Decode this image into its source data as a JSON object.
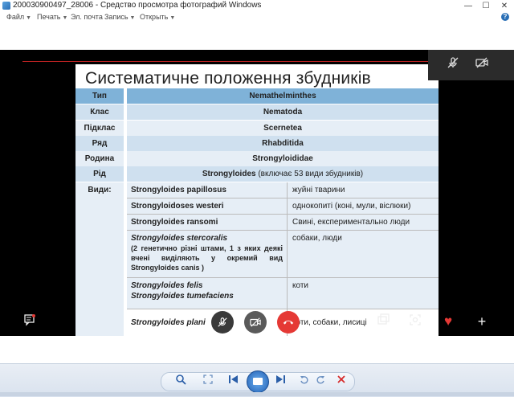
{
  "window": {
    "title": "200030900497_28006 - Средство просмотра фотографий Windows",
    "minimize": "—",
    "maximize": "☐",
    "close": "✕"
  },
  "menu": {
    "items": [
      "Файл",
      "Печать",
      "Эл. почта",
      "Запись",
      "Открыть"
    ],
    "help": "?"
  },
  "slide": {
    "title": "Систематичне положення збудників",
    "rows": [
      {
        "label": "Тип",
        "value": "Nemathelminthes"
      },
      {
        "label": "Клас",
        "value": "Nematoda"
      },
      {
        "label": "Підклас",
        "value": "Scernetea"
      },
      {
        "label": "Ряд",
        "value": "Rhabditida"
      },
      {
        "label": "Родина",
        "value": "Strongyloididae"
      },
      {
        "label": "Рід",
        "value": "Strongyloides",
        "value_extra": " (включає 53 види збудників)"
      }
    ],
    "species_label": "Види:",
    "species": [
      {
        "name": "Strongyloides  papillosus",
        "host": "жуйні тварини"
      },
      {
        "name": "Strongyloidoses westeri",
        "host": "однокопиті (коні, мули, віслюки)"
      },
      {
        "name": "Strongyloides ransomi",
        "host": "Свині, експериментально люди"
      },
      {
        "name": "Strongyloides stercoralis",
        "note": "(2 генетично різні штами, 1 з яких деякі вчені виділяють у окремий вид Strongyloides canis )",
        "host": "собаки, люди"
      },
      {
        "name": "Strongyloides felis",
        "name2": "Strongyloides tumefaciens",
        "host": "коти"
      },
      {
        "name": "Strongyloides plani",
        "host": "коти, собаки, лисиці"
      }
    ]
  },
  "colors": {
    "header_blue": "#7fb2d8",
    "row_light": "#cfe0ef",
    "end_call_red": "#e53935",
    "heart_red": "#e53935"
  },
  "toolbar": {
    "icons": [
      "zoom-icon",
      "fit-icon",
      "prev-icon",
      "slideshow-icon",
      "next-icon",
      "rotate-left-icon",
      "rotate-right-icon",
      "delete-icon"
    ]
  }
}
